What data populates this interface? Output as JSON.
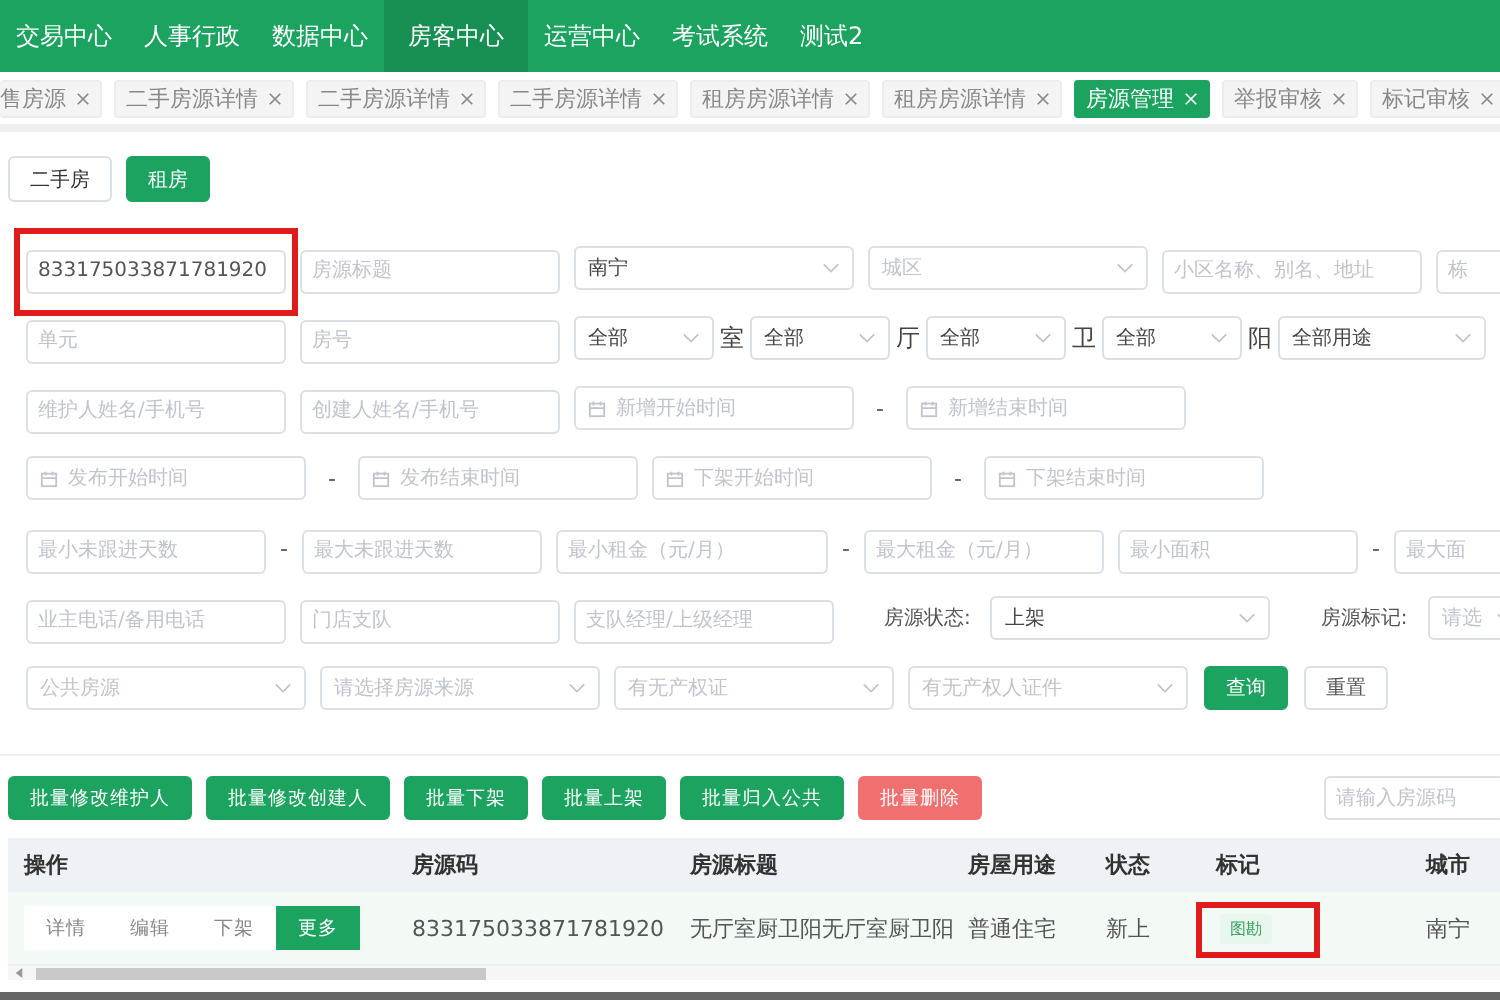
{
  "nav": [
    {
      "label": "交易中心",
      "selected": false
    },
    {
      "label": "人事行政",
      "selected": false
    },
    {
      "label": "数据中心",
      "selected": false
    },
    {
      "label": "房客中心",
      "selected": true
    },
    {
      "label": "运营中心",
      "selected": false
    },
    {
      "label": "考试系统",
      "selected": false
    },
    {
      "label": "测试2",
      "selected": false
    }
  ],
  "tabs": [
    {
      "label": "售房源",
      "selected": false
    },
    {
      "label": "二手房源详情",
      "selected": false
    },
    {
      "label": "二手房源详情",
      "selected": false
    },
    {
      "label": "二手房源详情",
      "selected": false
    },
    {
      "label": "租房房源详情",
      "selected": false
    },
    {
      "label": "租房房源详情",
      "selected": false
    },
    {
      "label": "房源管理",
      "selected": true
    },
    {
      "label": "举报审核",
      "selected": false
    },
    {
      "label": "标记审核",
      "selected": false
    }
  ],
  "type_toggle": [
    {
      "label": "二手房",
      "selected": false
    },
    {
      "label": "租房",
      "selected": true
    }
  ],
  "filters": [
    [
      {
        "kind": "input",
        "value": "833175033871781920",
        "highlighted": true
      },
      {
        "kind": "input",
        "placeholder": "房源标题"
      },
      {
        "kind": "select",
        "value": "南宁"
      },
      {
        "kind": "select",
        "placeholder": "城区"
      },
      {
        "kind": "input",
        "placeholder": "小区名称、别名、地址"
      },
      {
        "kind": "input",
        "placeholder": "栋"
      }
    ],
    [
      {
        "kind": "input",
        "placeholder": "单元"
      },
      {
        "kind": "input",
        "placeholder": "房号"
      },
      {
        "kind": "select",
        "value": "全部"
      },
      {
        "kind": "unit",
        "label": "室"
      },
      {
        "kind": "select",
        "value": "全部"
      },
      {
        "kind": "unit",
        "label": "厅"
      },
      {
        "kind": "select",
        "value": "全部"
      },
      {
        "kind": "unit",
        "label": "卫"
      },
      {
        "kind": "select",
        "value": "全部"
      },
      {
        "kind": "unit",
        "label": "阳"
      },
      {
        "kind": "select",
        "value": "全部用途"
      }
    ],
    [
      {
        "kind": "input",
        "placeholder": "维护人姓名/手机号"
      },
      {
        "kind": "input",
        "placeholder": "创建人姓名/手机号"
      },
      {
        "kind": "date",
        "placeholder": "新增开始时间"
      },
      {
        "kind": "dash",
        "label": "-"
      },
      {
        "kind": "date",
        "placeholder": "新增结束时间"
      }
    ],
    [
      {
        "kind": "date",
        "placeholder": "发布开始时间"
      },
      {
        "kind": "dash",
        "label": "-"
      },
      {
        "kind": "date",
        "placeholder": "发布结束时间"
      },
      {
        "kind": "date",
        "placeholder": "下架开始时间"
      },
      {
        "kind": "dash",
        "label": "-"
      },
      {
        "kind": "date",
        "placeholder": "下架结束时间"
      }
    ],
    [
      {
        "kind": "input",
        "placeholder": "最小未跟进天数"
      },
      {
        "kind": "dash",
        "label": "-"
      },
      {
        "kind": "input",
        "placeholder": "最大未跟进天数"
      },
      {
        "kind": "input",
        "placeholder": "最小租金（元/月）"
      },
      {
        "kind": "dash",
        "label": "-"
      },
      {
        "kind": "input",
        "placeholder": "最大租金（元/月）"
      },
      {
        "kind": "input",
        "placeholder": "最小面积"
      },
      {
        "kind": "dash",
        "label": "-"
      },
      {
        "kind": "input",
        "placeholder": "最大面"
      }
    ],
    [
      {
        "kind": "input",
        "placeholder": "业主电话/备用电话"
      },
      {
        "kind": "input",
        "placeholder": "门店支队"
      },
      {
        "kind": "input",
        "placeholder": "支队经理/上级经理"
      },
      {
        "kind": "label",
        "label": "房源状态:"
      },
      {
        "kind": "select",
        "value": "上架"
      },
      {
        "kind": "label",
        "label": "房源标记:"
      },
      {
        "kind": "select",
        "placeholder": "请选"
      }
    ],
    [
      {
        "kind": "select",
        "placeholder": "公共房源"
      },
      {
        "kind": "select",
        "placeholder": "请选择房源来源"
      },
      {
        "kind": "select",
        "placeholder": "有无产权证"
      },
      {
        "kind": "select",
        "placeholder": "有无产权人证件"
      },
      {
        "kind": "button",
        "label": "查询",
        "primary": true
      },
      {
        "kind": "button",
        "label": "重置",
        "primary": false
      }
    ]
  ],
  "actions": [
    {
      "label": "批量修改维护人",
      "kind": "primary"
    },
    {
      "label": "批量修改创建人",
      "kind": "primary"
    },
    {
      "label": "批量下架",
      "kind": "primary"
    },
    {
      "label": "批量上架",
      "kind": "primary"
    },
    {
      "label": "批量归入公共",
      "kind": "primary"
    },
    {
      "label": "批量删除",
      "kind": "danger"
    }
  ],
  "code_search": {
    "placeholder": "请输入房源码"
  },
  "table": {
    "columns": [
      "操作",
      "房源码",
      "房源标题",
      "房屋用途",
      "状态",
      "标记",
      "城市"
    ],
    "rows": [
      {
        "hovered": true,
        "ops": [
          {
            "label": "详情",
            "primary": false
          },
          {
            "label": "编辑",
            "primary": false
          },
          {
            "label": "下架",
            "primary": false
          },
          {
            "label": "更多",
            "primary": true
          }
        ],
        "code": "833175033871781920",
        "title": "无厅室厨卫阳无厅室厨卫阳",
        "usage": "普通住宅",
        "status": "新上",
        "tag": {
          "label": "图勘",
          "highlighted": true
        },
        "city": "南宁"
      }
    ]
  }
}
